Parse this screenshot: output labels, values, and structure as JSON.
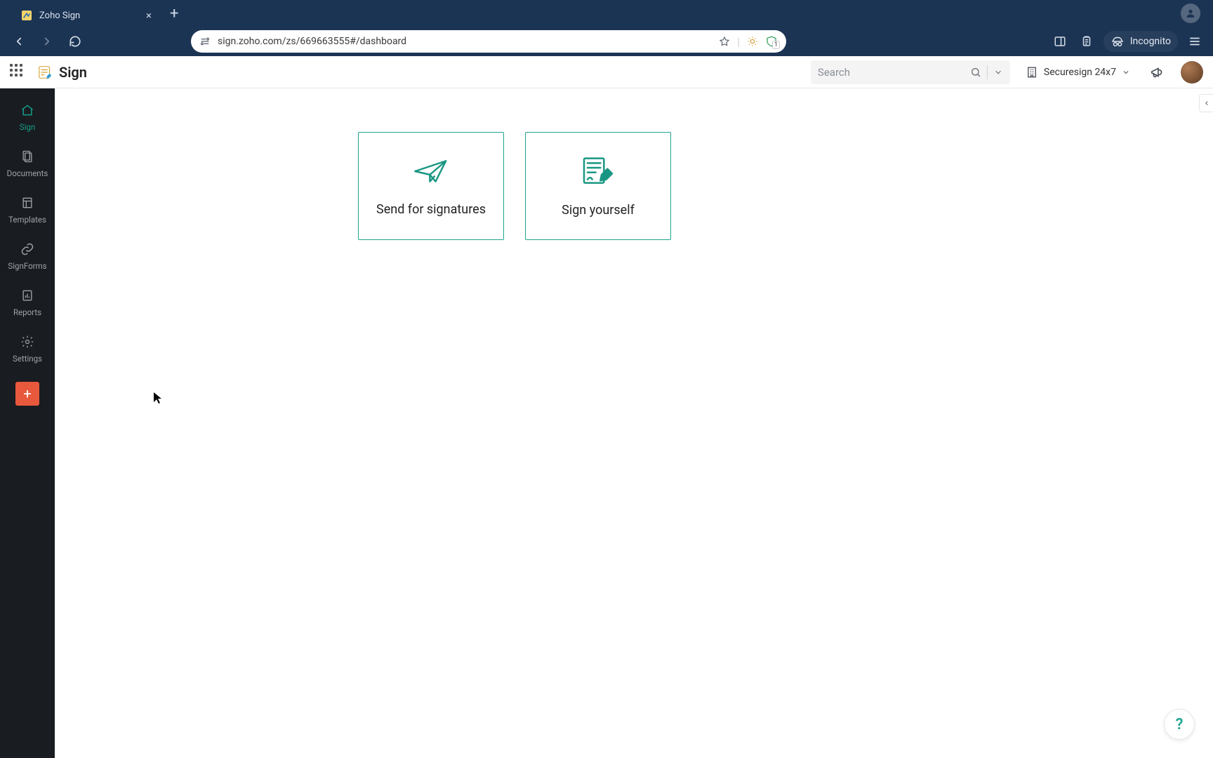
{
  "browser": {
    "tab_title": "Zoho Sign",
    "url": "sign.zoho.com/zs/669663555#/dashboard",
    "incognito_label": "Incognito",
    "shield_count": "1"
  },
  "header": {
    "app_name": "Sign",
    "search_placeholder": "Search",
    "org_label": "Securesign 24x7"
  },
  "sidebar": {
    "items": [
      {
        "label": "Sign"
      },
      {
        "label": "Documents"
      },
      {
        "label": "Templates"
      },
      {
        "label": "SignForms"
      },
      {
        "label": "Reports"
      },
      {
        "label": "Settings"
      }
    ]
  },
  "main": {
    "cards": [
      {
        "label": "Send for signatures"
      },
      {
        "label": "Sign yourself"
      }
    ],
    "help_label": "?"
  },
  "colors": {
    "accent": "#1ea58f",
    "sidebar_bg": "#191c20",
    "chrome_bg": "#1c3454",
    "add_button": "#e8583d"
  }
}
